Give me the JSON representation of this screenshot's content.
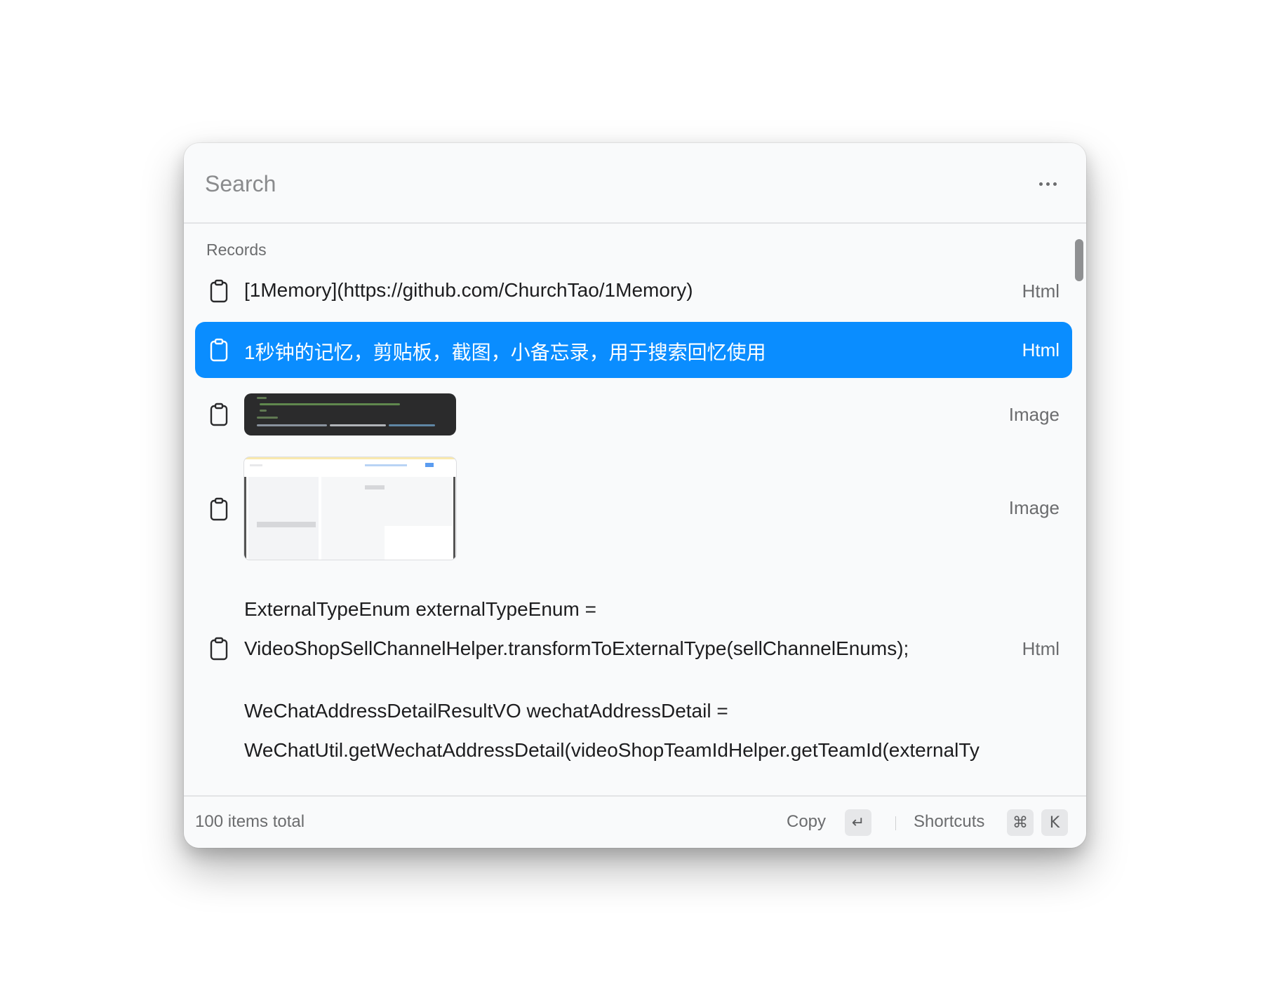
{
  "search": {
    "placeholder": "Search",
    "value": ""
  },
  "header": {
    "more_icon": "more-horizontal-icon"
  },
  "records": {
    "section_label": "Records",
    "items": [
      {
        "icon": "clipboard-icon",
        "text": "[1Memory](https://github.com/ChurchTao/1Memory)",
        "type": "Html",
        "selected": false
      },
      {
        "icon": "clipboard-icon",
        "text": "1秒钟的记忆，剪贴板，截图，小备忘录，用于搜索回忆使用",
        "type": "Html",
        "selected": true
      },
      {
        "icon": "clipboard-icon",
        "text": "",
        "type": "Image",
        "selected": false
      },
      {
        "icon": "clipboard-icon",
        "text": "",
        "type": "Image",
        "selected": false
      },
      {
        "icon": "clipboard-icon",
        "lines": [
          "ExternalTypeEnum externalTypeEnum =",
          "VideoShopSellChannelHelper.transformToExternalType(sellChannelEnums);",
          "",
          "WeChatAddressDetailResultVO wechatAddressDetail =",
          "WeChatUtil.getWechatAddressDetail(videoShopTeamIdHelper.getTeamId(externalTy"
        ],
        "type": "Html",
        "selected": false
      }
    ]
  },
  "footer": {
    "total": "100 items total",
    "copy_label": "Copy",
    "copy_key": "↵",
    "shortcuts_label": "Shortcuts",
    "shortcut_key_1": "⌘",
    "shortcut_key_2": "K"
  },
  "colors": {
    "selected_bg": "#0a8dff",
    "window_bg": "#f9fafb"
  }
}
